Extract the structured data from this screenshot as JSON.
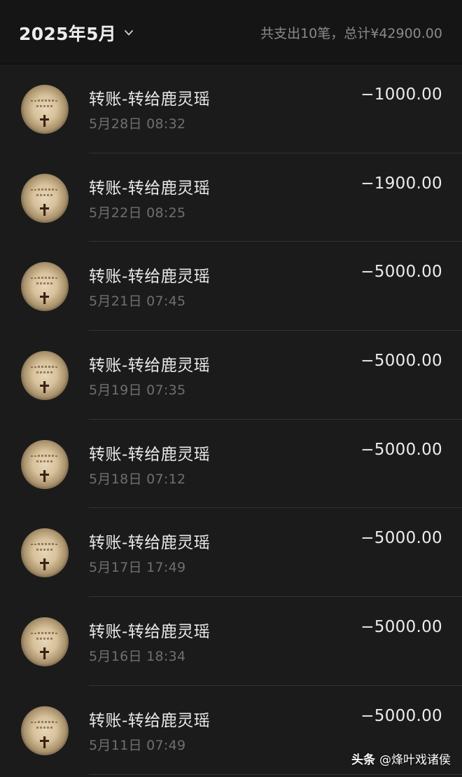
{
  "header": {
    "month_label": "2025年5月",
    "summary": "共支出10笔，总计¥42900.00"
  },
  "transactions": [
    {
      "title": "转账-转给鹿灵瑶",
      "time": "5月28日 08:32",
      "amount": "−1000.00"
    },
    {
      "title": "转账-转给鹿灵瑶",
      "time": "5月22日 08:25",
      "amount": "−1900.00"
    },
    {
      "title": "转账-转给鹿灵瑶",
      "time": "5月21日 07:45",
      "amount": "−5000.00"
    },
    {
      "title": "转账-转给鹿灵瑶",
      "time": "5月19日 07:35",
      "amount": "−5000.00"
    },
    {
      "title": "转账-转给鹿灵瑶",
      "time": "5月18日 07:12",
      "amount": "−5000.00"
    },
    {
      "title": "转账-转给鹿灵瑶",
      "time": "5月17日 17:49",
      "amount": "−5000.00"
    },
    {
      "title": "转账-转给鹿灵瑶",
      "time": "5月16日 18:34",
      "amount": "−5000.00"
    },
    {
      "title": "转账-转给鹿灵瑶",
      "time": "5月11日 07:49",
      "amount": "−5000.00"
    }
  ],
  "watermark": {
    "platform": "头条",
    "author": "@烽叶戏诸侯"
  },
  "icons": {
    "month_dropdown": "chevron-down-icon",
    "avatar": "cross-avatar-icon"
  },
  "colors": {
    "background": "#1b1b1b",
    "header_background": "#151515",
    "primary_text": "#e9e9e9",
    "secondary_text": "#6f6f6f",
    "summary_text": "#8a8a8a"
  }
}
